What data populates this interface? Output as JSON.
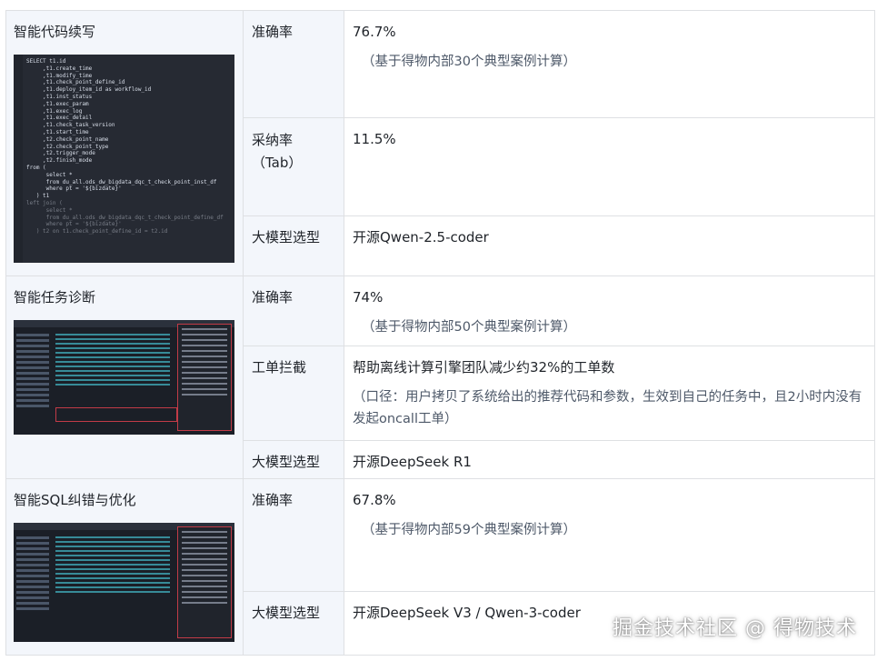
{
  "rows": [
    {
      "feature": "智能代码续写",
      "metrics": [
        {
          "label": "准确率",
          "value": "76.7%",
          "note": "（基于得物内部30个典型案例计算）"
        },
        {
          "label": "采纳率（Tab）",
          "value": "11.5%",
          "note": ""
        },
        {
          "label": "大模型选型",
          "value": "开源Qwen-2.5-coder",
          "note": ""
        }
      ],
      "code_lines": [
        "SELECT t1.id",
        "     ,t1.create_time",
        "     ,t1.modify_time",
        "     ,t1.check_point_define_id",
        "     ,t1.deploy_item_id as workflow_id",
        "     ,t1.inst_status",
        "     ,t1.exec_param",
        "     ,t1.exec_log",
        "     ,t1.exec_detail",
        "     ,t1.check_task_version",
        "     ,t1.start_time",
        "     ,t2.check_point_name",
        "     ,t2.check_point_type",
        "     ,t2.trigger_mode",
        "     ,t2.finish_mode",
        "from (",
        "      select *",
        "      from du_all.ods_dw_bigdata_dqc_t_check_point_inst_df",
        "      where pt = '${bizdate}'",
        "   ) t1",
        "left join (",
        "      select *",
        "      from du_all.ods_dw_bigdata_dqc_t_check_point_define_df",
        "      where pt = '${bizdate}'",
        "   ) t2 on t1.check_point_define_id = t2.id"
      ]
    },
    {
      "feature": "智能任务诊断",
      "metrics": [
        {
          "label": "准确率",
          "value": "74%",
          "note": "（基于得物内部50个典型案例计算）"
        },
        {
          "label": "工单拦截",
          "value": "帮助离线计算引擎团队减少约32%的工单数",
          "note": "（口径：用户拷贝了系统给出的推荐代码和参数，生效到自己的任务中，且2小时内没有发起oncall工单）"
        },
        {
          "label": "大模型选型",
          "value": "开源DeepSeek R1",
          "note": ""
        }
      ]
    },
    {
      "feature": "智能SQL纠错与优化",
      "metrics": [
        {
          "label": "准确率",
          "value": "67.8%",
          "note": "（基于得物内部59个典型案例计算）"
        },
        {
          "label": "大模型选型",
          "value": "开源DeepSeek V3 / Qwen-3-coder",
          "note": ""
        }
      ]
    }
  ],
  "watermark": "掘金技术社区 @ 得物技术"
}
